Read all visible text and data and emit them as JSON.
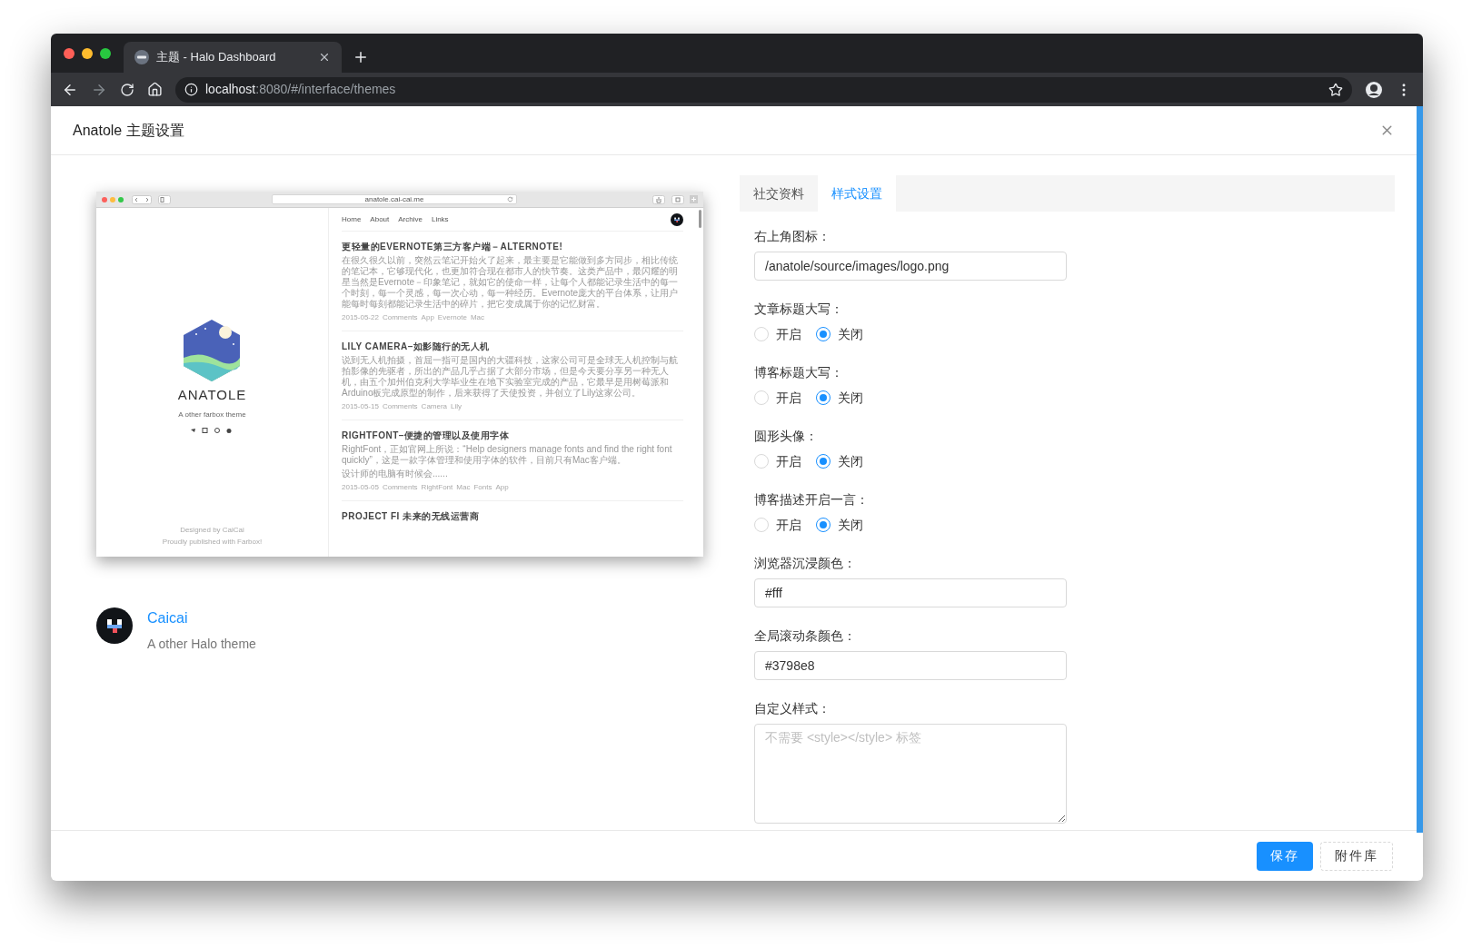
{
  "browser": {
    "tab": {
      "title": "主题 - Halo Dashboard"
    },
    "url_host": "localhost",
    "url_path": ":8080/#/interface/themes"
  },
  "dialog": {
    "title": "Anatole 主题设置"
  },
  "preview": {
    "url": "anatole.cai-cai.me",
    "site_title": "ANATOLE",
    "tagline": "A other farbox theme",
    "footer": [
      "Designed by CaiCai",
      "Proudly published with Farbox!"
    ],
    "nav": [
      "Home",
      "About",
      "Archive",
      "Links"
    ],
    "posts": [
      {
        "title": "更轻量的EVERNOTE第三方客户端－ALTERNOTE!",
        "excerpt": [
          "在很久很久以前，突然云笔记开始火了起来，最主要是它能做到多方同步，相比传统的笔记本，它够现代化，也更加符合现在都市人的快节奏。这类产品中，最闪耀的明星当然是Evernote－印象笔记，就如它的使命一样，让每个人都能记录生活中的每一个时刻，每一个灵感，每一次心动，每一种经历。Evernote庞大的平台体系，让用户能每时每刻都能记录生活中的碎片，把它变成属于你的记忆财富。"
        ],
        "date": "2015-05-22",
        "comments": "Comments",
        "tags": [
          "App",
          "Evernote",
          "Mac"
        ]
      },
      {
        "title": "LILY CAMERA–如影随行的无人机",
        "excerpt": [
          "说到无人机拍摄，首屈一指可是国内的大疆科技，这家公司可是全球无人机控制与航拍影像的先驱者，所出的产品几乎占据了大部分市场，但是今天要分享另一种无人机，由五个加州伯克利大学毕业生在地下实验室完成的产品，它最早是用树莓派和Arduino板完成原型的制作，后来获得了天使投资，并创立了Lily这家公司。"
        ],
        "date": "2015-05-15",
        "comments": "Comments",
        "tags": [
          "Camera",
          "Lily"
        ]
      },
      {
        "title": "RIGHTFONT–便捷的管理以及使用字体",
        "excerpt": [
          "RightFont，正如官网上所说：“Help designers manage fonts and find the right font quickly”，这是一款字体管理和使用字体的软件，目前只有Mac客户端。",
          "设计师的电脑有时候会......"
        ],
        "date": "2015-05-05",
        "comments": "Comments",
        "tags": [
          "RightFont",
          "Mac",
          "Fonts",
          "App"
        ]
      },
      {
        "title": "PROJECT FI 未来的无线运营商"
      }
    ]
  },
  "theme": {
    "author": "Caicai",
    "description": "A other Halo theme"
  },
  "form": {
    "tabs": [
      {
        "label": "社交资料",
        "selected": false
      },
      {
        "label": "样式设置",
        "selected": true
      }
    ],
    "fields": [
      {
        "kind": "input",
        "label": "右上角图标：",
        "value": "/anatole/source/images/logo.png"
      },
      {
        "kind": "radio",
        "label": "文章标题大写：",
        "options": [
          {
            "label": "开启",
            "selected": false
          },
          {
            "label": "关闭",
            "selected": true
          }
        ]
      },
      {
        "kind": "radio",
        "label": "博客标题大写：",
        "options": [
          {
            "label": "开启",
            "selected": false
          },
          {
            "label": "关闭",
            "selected": true
          }
        ]
      },
      {
        "kind": "radio",
        "label": "圆形头像：",
        "options": [
          {
            "label": "开启",
            "selected": false
          },
          {
            "label": "关闭",
            "selected": true
          }
        ]
      },
      {
        "kind": "radio",
        "label": "博客描述开启一言：",
        "options": [
          {
            "label": "开启",
            "selected": false
          },
          {
            "label": "关闭",
            "selected": true
          }
        ]
      },
      {
        "kind": "input",
        "label": "浏览器沉浸颜色：",
        "value": "#fff"
      },
      {
        "kind": "input",
        "label": "全局滚动条颜色：",
        "value": "#3798e8"
      },
      {
        "kind": "textarea",
        "label": "自定义样式：",
        "placeholder": "不需要 <style></style> 标签"
      }
    ]
  },
  "footer": {
    "buttons": [
      {
        "label": "保存",
        "kind": "primary"
      },
      {
        "label": "附件库",
        "kind": "dashed"
      }
    ]
  }
}
